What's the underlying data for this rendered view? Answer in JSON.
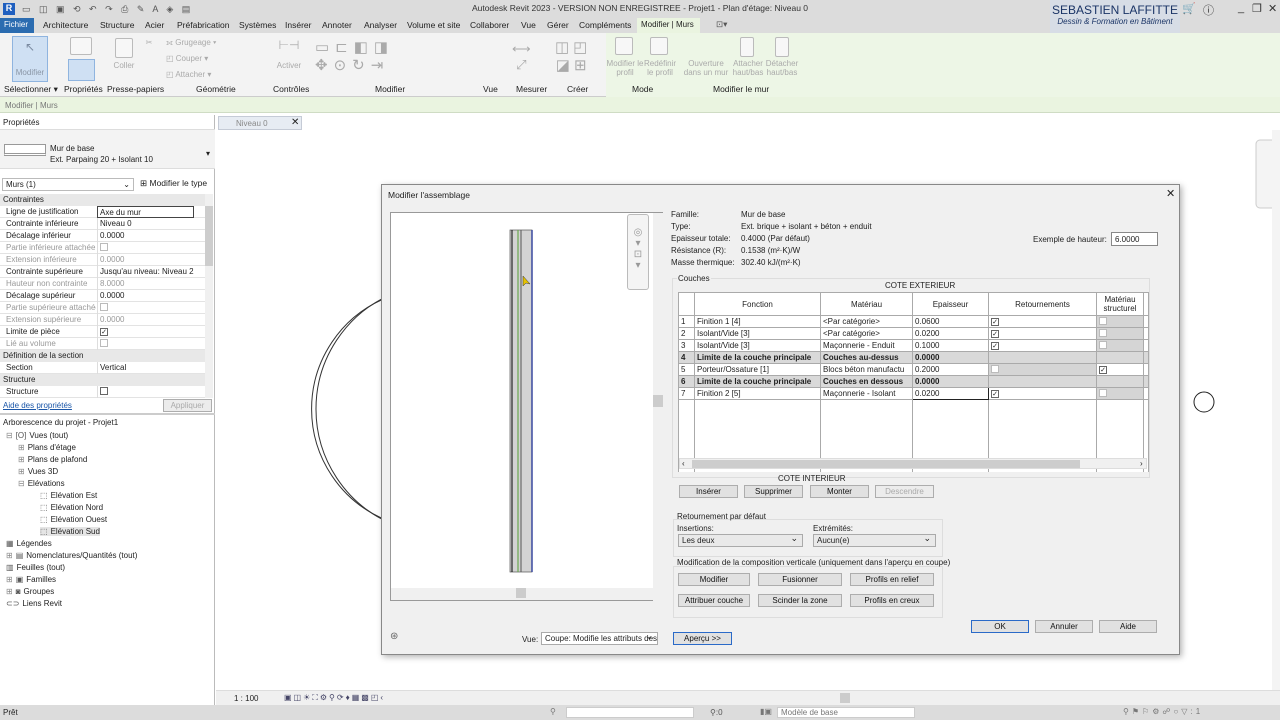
{
  "app": {
    "title": "Autodesk Revit 2023 - VERSION NON ENREGISTREE - Projet1 - Plan d'étage: Niveau 0",
    "brand_name": "SEBASTIEN LAFFITTE",
    "brand_sub": "Dessin & Formation en Bâtiment"
  },
  "tabs": [
    "Fichier",
    "Architecture",
    "Structure",
    "Acier",
    "Préfabrication",
    "Systèmes",
    "Insérer",
    "Annoter",
    "Analyser",
    "Volume et site",
    "Collaborer",
    "Vue",
    "Gérer",
    "Compléments",
    "Modifier | Murs"
  ],
  "ribbon": {
    "modifier": "Modifier",
    "coller": "Coller",
    "grugeage": "Grugeage",
    "couper": "Couper",
    "attacher": "Attacher",
    "activer": "Activer",
    "modifier_profil": "Modifier le profil",
    "redefinir_profil": "Redéfinir le profil",
    "ouverture": "Ouverture dans un mur",
    "attacher_hb": "Attacher haut/bas",
    "detacher_hb": "Détacher haut/bas",
    "panels": [
      "Sélectionner ▾",
      "Propriétés",
      "Presse-papiers",
      "Géométrie",
      "Contrôles",
      "Modifier",
      "Vue",
      "Mesurer",
      "Créer",
      "Mode",
      "Modifier le mur"
    ]
  },
  "context_bar": "Modifier | Murs",
  "properties": {
    "title": "Propriétés",
    "family": "Mur de base",
    "type": "Ext. Parpaing 20 + Isolant 10",
    "filter": "Murs (1)",
    "edit_type": "Modifier le type",
    "groups": {
      "contraintes": "Contraintes",
      "section": "Définition de la section",
      "structure": "Structure"
    },
    "rows": [
      {
        "k": "Ligne de justification",
        "v": "Axe du mur"
      },
      {
        "k": "Contrainte inférieure",
        "v": "Niveau 0"
      },
      {
        "k": "Décalage inférieur",
        "v": "0.0000"
      },
      {
        "k": "Partie inférieure attachée",
        "v": ""
      },
      {
        "k": "Extension inférieure",
        "v": "0.0000"
      },
      {
        "k": "Contrainte supérieure",
        "v": "Jusqu'au niveau: Niveau 2"
      },
      {
        "k": "Hauteur non contrainte",
        "v": "8.0000"
      },
      {
        "k": "Décalage supérieur",
        "v": "0.0000"
      },
      {
        "k": "Partie supérieure attachée",
        "v": ""
      },
      {
        "k": "Extension supérieure",
        "v": "0.0000"
      },
      {
        "k": "Limite de pièce",
        "v": ""
      },
      {
        "k": "Lié au volume",
        "v": ""
      }
    ],
    "section_k": "Section",
    "section_v": "Vertical",
    "structure_k": "Structure",
    "help": "Aide des propriétés",
    "apply": "Appliquer"
  },
  "browser": {
    "title": "Arborescence du projet - Projet1",
    "items": [
      "Vues (tout)",
      "Plans d'étage",
      "Plans de plafond",
      "Vues 3D",
      "Elévations",
      "Elévation Est",
      "Elévation Nord",
      "Elévation Ouest",
      "Elévation Sud",
      "Légendes",
      "Nomenclatures/Quantités (tout)",
      "Feuilles (tout)",
      "Familles",
      "Groupes",
      "Liens Revit"
    ]
  },
  "view_tab": "Niveau 0",
  "view_scale": "1 : 100",
  "dialog": {
    "title": "Modifier l'assemblage",
    "info": [
      {
        "k": "Famille:",
        "v": "Mur de base"
      },
      {
        "k": "Type:",
        "v": "Ext. brique + isolant + béton + enduit"
      },
      {
        "k": "Epaisseur totale:",
        "v": "0.4000 (Par défaut)"
      },
      {
        "k": "Résistance (R):",
        "v": "0.1538 (m²·K)/W"
      },
      {
        "k": "Masse thermique:",
        "v": "302.40 kJ/(m²·K)"
      }
    ],
    "sample_height_label": "Exemple de hauteur:",
    "sample_height": "6.0000",
    "layers_label": "Couches",
    "exterior": "COTE EXTERIEUR",
    "interior": "COTE INTERIEUR",
    "columns": [
      "Fonction",
      "Matériau",
      "Epaisseur",
      "Retournements",
      "Matériau structurel"
    ],
    "rows": [
      {
        "n": "1",
        "f": "Finition 1 [4]",
        "m": "<Par catégorie>",
        "e": "0.0600",
        "r": true,
        "s": false,
        "core": false
      },
      {
        "n": "2",
        "f": "Isolant/Vide [3]",
        "m": "<Par catégorie>",
        "e": "0.0200",
        "r": true,
        "s": false,
        "core": false
      },
      {
        "n": "3",
        "f": "Isolant/Vide [3]",
        "m": "Maçonnerie - Enduit",
        "e": "0.1000",
        "r": true,
        "s": false,
        "core": false
      },
      {
        "n": "4",
        "f": "Limite de la couche principale",
        "m": "Couches au-dessus",
        "e": "0.0000",
        "core": true
      },
      {
        "n": "5",
        "f": "Porteur/Ossature [1]",
        "m": "Blocs béton manufactu",
        "e": "0.2000",
        "r": false,
        "s": true,
        "core": false
      },
      {
        "n": "6",
        "f": "Limite de la couche principale",
        "m": "Couches en dessous",
        "e": "0.0000",
        "core": true
      },
      {
        "n": "7",
        "f": "Finition 2 [5]",
        "m": "Maçonnerie - Isolant",
        "e": "0.0200",
        "r": true,
        "s": false,
        "core": false
      }
    ],
    "insert": "Insérer",
    "delete": "Supprimer",
    "up": "Monter",
    "down": "Descendre",
    "wrap_label": "Retournement par défaut",
    "insertions_label": "Insertions:",
    "insertions": "Les deux",
    "ends_label": "Extrémités:",
    "ends": "Aucun(e)",
    "vertical_label": "Modification de la composition verticale (uniquement dans l'aperçu en coupe)",
    "modify": "Modifier",
    "merge": "Fusionner",
    "sweeps": "Profils en relief",
    "assign": "Attribuer couche",
    "split": "Scinder la zone",
    "reveals": "Profils en creux",
    "ok": "OK",
    "cancel": "Annuler",
    "help": "Aide",
    "view_label": "Vue:",
    "view": "Coupe: Modifie les attributs des",
    "preview": "Aperçu >>"
  },
  "status": {
    "ready": "Prêt",
    "zero": ":0",
    "model": "Modèle de base",
    "filter": ":1"
  }
}
